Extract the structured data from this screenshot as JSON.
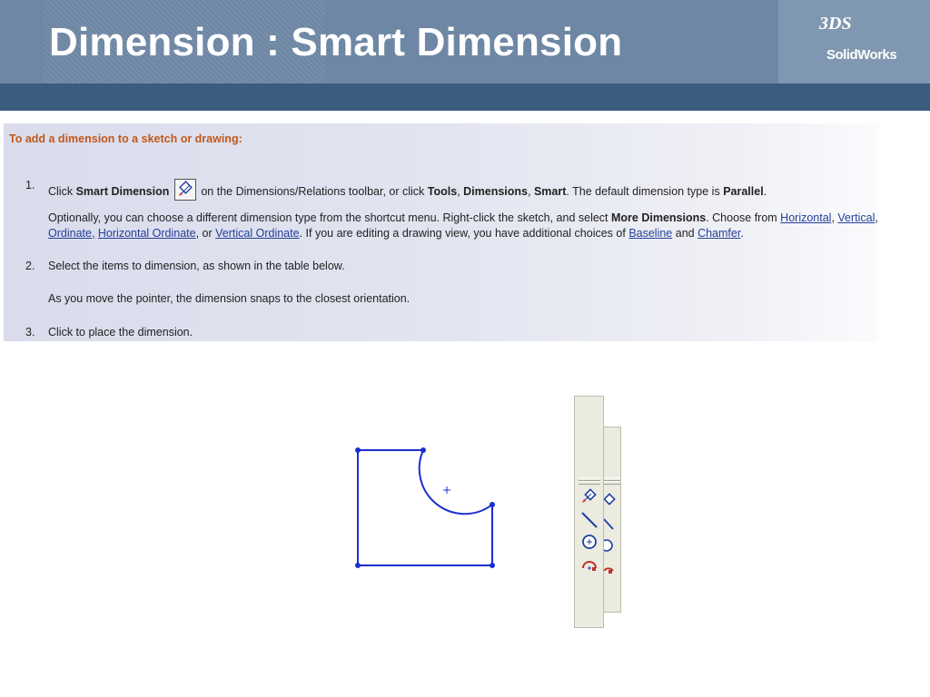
{
  "slide": {
    "title": "Dimension : Smart Dimension",
    "logo": {
      "mark": "3DS",
      "text": "SolidWorks"
    }
  },
  "instructions": {
    "heading": "To add a dimension to a sketch or drawing:",
    "steps": [
      {
        "number": "1.",
        "line1": {
          "t1": "Click ",
          "b1": "Smart Dimension",
          "icon": "smart-dimension-icon",
          "t2": " on the Dimensions/Relations toolbar, or click ",
          "b2": "Tools",
          "t3": ", ",
          "b3": "Dimensions",
          "t4": ", ",
          "b4": "Smart",
          "t5": ". The default dimension type is ",
          "b5": "Parallel",
          "t6": "."
        },
        "para2_line1": {
          "t1": "Optionally, you can choose a different dimension type from the shortcut menu. Right-click the sketch, and select ",
          "b1": "More Dimensions",
          "t2": ". Choose from ",
          "l1": "Horizontal",
          "t3": ", ",
          "l2": "Vertical",
          "t4": ","
        },
        "para2_line2": {
          "l1": "Ordinate,",
          "t1": " ",
          "l2": "Horizontal Ordinate",
          "t2": ", or ",
          "l3": "Vertical Ordinate",
          "t3": ". If you are editing a drawing view, you have additional choices of ",
          "l4": "Baseline",
          "t4": " and ",
          "l5": "Chamfer",
          "t5": "."
        }
      },
      {
        "number": "2.",
        "text": "Select the items to dimension, as shown in the table below.",
        "note": "As you move the pointer, the dimension snaps to the closest orientation."
      },
      {
        "number": "3.",
        "text": "Click to place the dimension."
      }
    ]
  },
  "toolbar": {
    "buttons": [
      {
        "icon": "smart-dimension-icon",
        "color": "#1f3fa0"
      },
      {
        "icon": "line-icon",
        "color": "#1f3fa0"
      },
      {
        "icon": "circle-icon",
        "color": "#1f3fa0"
      },
      {
        "icon": "arc-icon",
        "color": "#c0302a"
      }
    ]
  },
  "colors": {
    "header": "#6e87a4",
    "band": "#3b5c7e",
    "heading": "#c0581a",
    "link": "#23409a",
    "sketch": "#1a2fd0"
  }
}
